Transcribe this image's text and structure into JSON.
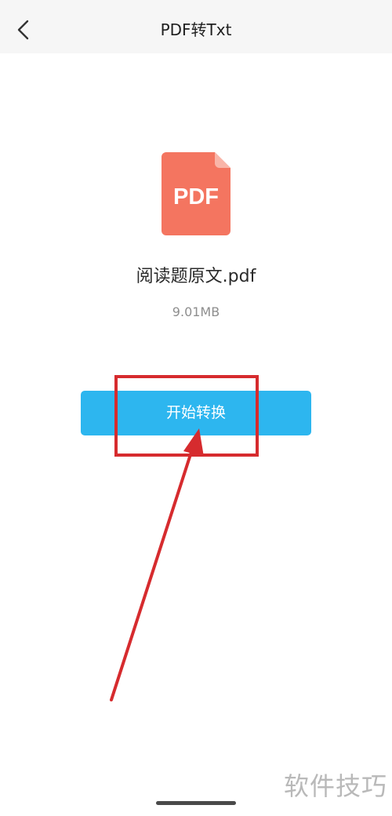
{
  "nav": {
    "title": "PDF转Txt",
    "back_icon": "chevron-left-icon"
  },
  "file": {
    "icon": "pdf-file-icon",
    "icon_label": "PDF",
    "icon_color": "#f47560",
    "name": "阅读题原文.pdf",
    "size": "9.01MB"
  },
  "actions": {
    "convert_label": "开始转换",
    "button_color": "#2db6ef"
  },
  "annotation": {
    "color": "#d62b2e"
  },
  "watermark": {
    "text": "软件技巧"
  }
}
